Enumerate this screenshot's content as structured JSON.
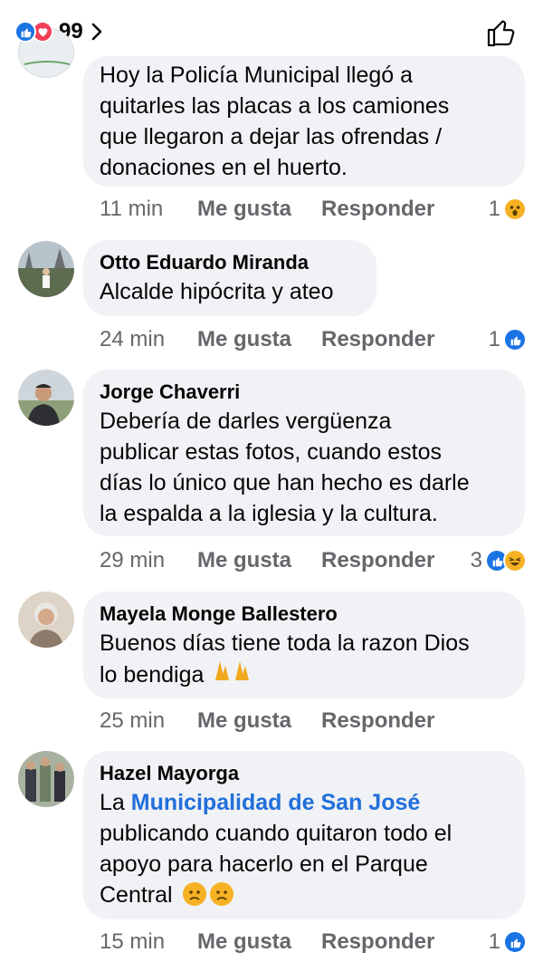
{
  "header": {
    "reaction_count": "99",
    "reactions": [
      "like-icon",
      "love-icon"
    ]
  },
  "comments": [
    {
      "author": "",
      "text": "Hoy la Policía Municipal llegó a quitarles las placas a los camiones que llegaron a dejar las ofrendas / donaciones en el huerto.",
      "lines": [
        "Hoy la Policía Municipal llegó a",
        "quitarles las placas a los camiones",
        "que llegaron a dejar las ofrendas /",
        "donaciones en el huerto."
      ],
      "time": "11 min",
      "like_label": "Me gusta",
      "reply_label": "Responder",
      "reaction_count": "1",
      "reactions": [
        "wow-icon"
      ]
    },
    {
      "author": "Otto Eduardo Miranda",
      "lines": [
        "Alcalde hipócrita y ateo"
      ],
      "time": "24 min",
      "like_label": "Me gusta",
      "reply_label": "Responder",
      "reaction_count": "1",
      "reactions": [
        "like-icon"
      ]
    },
    {
      "author": "Jorge Chaverri",
      "lines": [
        "Debería de darles vergüenza",
        "publicar estas fotos, cuando estos",
        "días lo único que han hecho es darle",
        "la espalda a la iglesia y la cultura."
      ],
      "time": "29 min",
      "like_label": "Me gusta",
      "reply_label": "Responder",
      "reaction_count": "3",
      "reactions": [
        "like-icon",
        "haha-icon"
      ]
    },
    {
      "author": "Mayela Monge Ballestero",
      "lines": [
        "Buenos días tiene toda la razon Dios",
        "lo bendiga"
      ],
      "emoji": "🙏🙏",
      "time": "25 min",
      "like_label": "Me gusta",
      "reply_label": "Responder",
      "reaction_count": "",
      "reactions": []
    },
    {
      "author": "Hazel Mayorga",
      "line1_prefix": "La ",
      "mention": "Municipalidad de San José",
      "lines": [
        "publicando cuando quitaron todo el",
        "apoyo para hacerlo en el Parque",
        "Central"
      ],
      "time": "15 min",
      "like_label": "Me gusta",
      "reply_label": "Responder",
      "reaction_count": "1",
      "reactions": [
        "like-icon"
      ]
    }
  ],
  "colors": {
    "like_blue": "#1b74e4",
    "love_red": "#f33e58",
    "bubble_bg": "#f0f2f5",
    "meta_gray": "#65676b",
    "mention_blue": "#216fdb"
  }
}
